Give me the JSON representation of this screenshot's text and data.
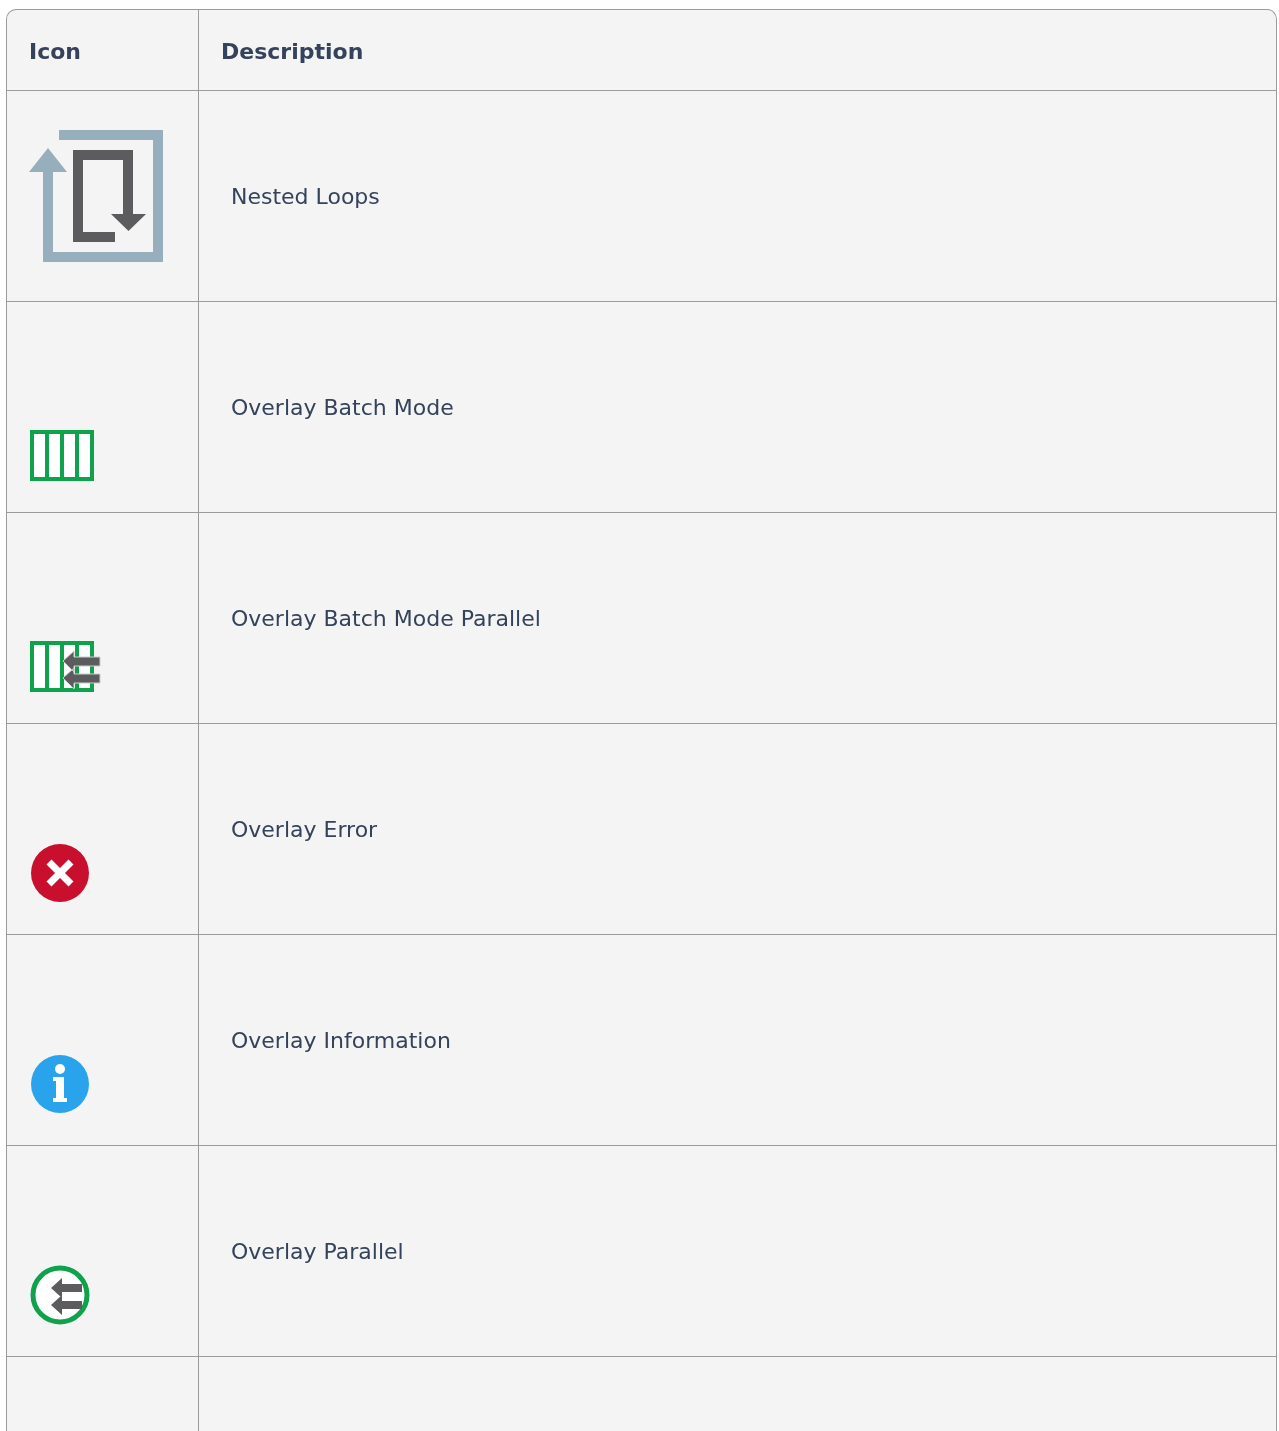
{
  "table": {
    "columns": [
      "Icon",
      "Description"
    ],
    "rows": [
      {
        "icon": {
          "kind": "nested-loops"
        },
        "description": "Nested Loops"
      },
      {
        "icon": {
          "kind": "batch"
        },
        "description": "Overlay Batch Mode"
      },
      {
        "icon": {
          "kind": "batch-parallel"
        },
        "description": "Overlay Batch Mode Parallel"
      },
      {
        "icon": {
          "kind": "error"
        },
        "description": "Overlay Error"
      },
      {
        "icon": {
          "kind": "info"
        },
        "description": "Overlay Information"
      },
      {
        "icon": {
          "kind": "parallel"
        },
        "description": "Overlay Parallel"
      }
    ]
  }
}
